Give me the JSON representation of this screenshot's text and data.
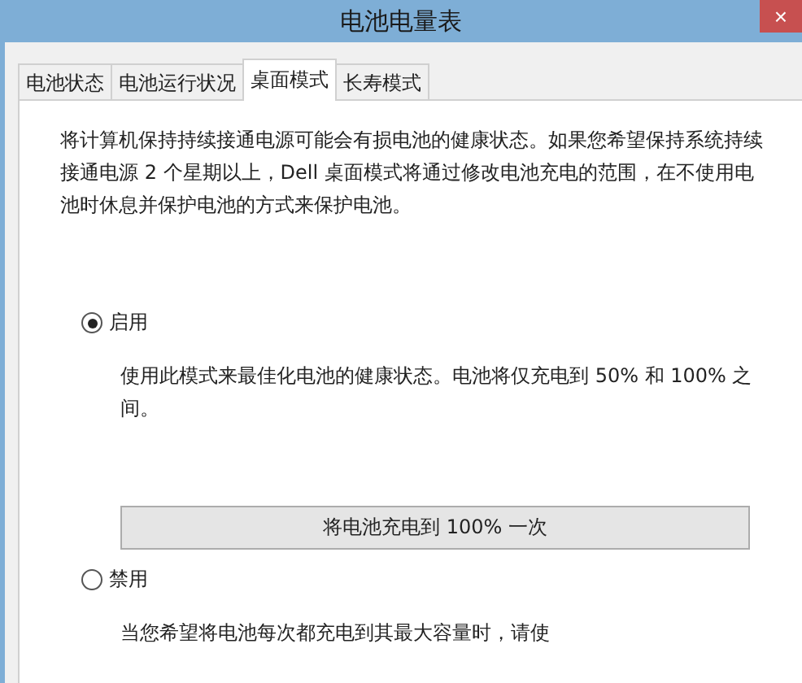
{
  "window": {
    "title": "电池电量表",
    "close": "×"
  },
  "tabs": [
    {
      "label": "电池状态",
      "selected": false
    },
    {
      "label": "电池运行状况",
      "selected": false
    },
    {
      "label": "桌面模式",
      "selected": true
    },
    {
      "label": "长寿模式",
      "selected": false
    }
  ],
  "intro": "将计算机保持持续接通电源可能会有损电池的健康状态。如果您希望保持系统持续接通电源 2 个星期以上，Dell 桌面模式将通过修改电池充电的范围，在不使用电池时休息并保护电池的方式来保护电池。",
  "options": [
    {
      "label": "启用",
      "selected": true,
      "description": "使用此模式来最佳化电池的健康状态。电池将仅充电到 50% 和 100% 之间。",
      "button": "将电池充电到 100% 一次"
    },
    {
      "label": "禁用",
      "selected": false,
      "description": "当您希望将电池每次都充电到其最大容量时，请使"
    }
  ]
}
